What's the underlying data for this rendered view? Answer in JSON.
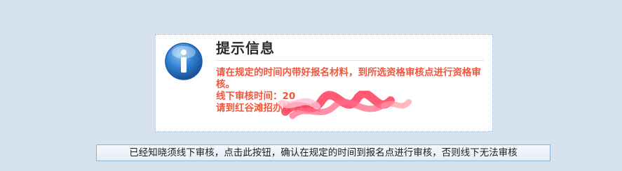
{
  "notice": {
    "icon": "info-icon",
    "title": "提示信息",
    "lines": [
      "请在规定的时间内带好报名材料，到所选资格审核点进行资格审核。",
      "线下审核时间：20",
      "请到红谷滩招办线下审核"
    ]
  },
  "confirm_button": {
    "label": "已经知晓须线下审核，点击此按钮，确认在规定的时间到报名点进行审核，否则线下无法审核"
  },
  "colors": {
    "page_background": "#d6e2ee",
    "notice_text": "#f2563d",
    "title_text": "#2b2b2b",
    "icon_blue": "#2f7fd1"
  }
}
